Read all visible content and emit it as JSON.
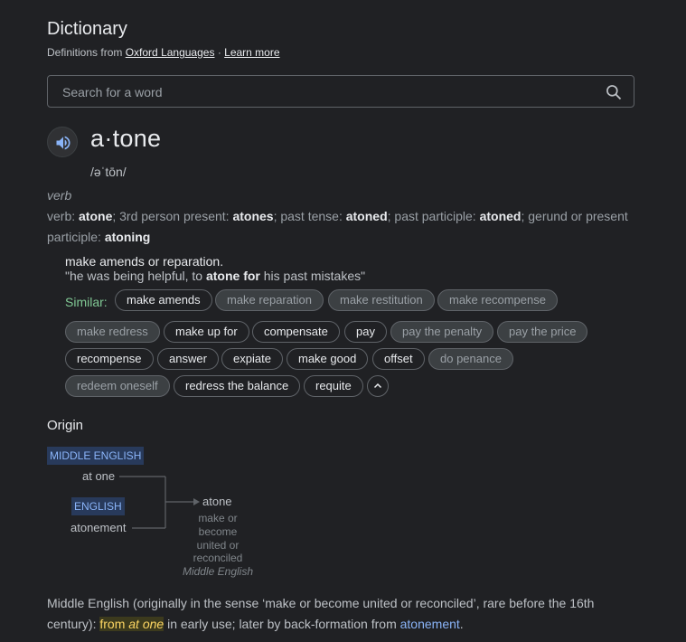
{
  "header": {
    "title": "Dictionary",
    "source_prefix": "Definitions from",
    "source_link": "Oxford Languages",
    "separator": "·",
    "learn_more": "Learn more"
  },
  "search": {
    "placeholder": "Search for a word",
    "icon": "search-icon"
  },
  "entry": {
    "speaker_icon": "speaker-icon",
    "word": "a·tone",
    "phonetic": "/əˈtōn/",
    "part_of_speech": "verb",
    "forms": {
      "label": "verb:",
      "base": "atone",
      "third_label": "3rd person present:",
      "third": "atones",
      "past_label": "past tense:",
      "past": "atoned",
      "pp_label": "past participle:",
      "pp": "atoned",
      "gerund_label": "gerund or present participle:",
      "gerund": "atoning"
    },
    "definition": "make amends or reparation.",
    "example": {
      "open": "\"he was being helpful, to",
      "bold": "atone for",
      "close": "his past mistakes\""
    },
    "similar_label": "Similar:",
    "similar": [
      "make amends",
      "make reparation",
      "make restitution",
      "make recompense",
      "make redress",
      "make up for",
      "compensate",
      "pay",
      "pay the penalty",
      "pay the price",
      "recompense",
      "answer",
      "expiate",
      "make good",
      "offset",
      "do penance",
      "redeem oneself",
      "redress the balance",
      "requite"
    ],
    "collapse_icon": "chevron-up-icon"
  },
  "origin": {
    "heading": "Origin",
    "badge_middle_english": "MIDDLE ENGLISH",
    "at_one": "at one",
    "badge_english": "ENGLISH",
    "atonement": "atonement",
    "result_word": "atone",
    "result_gloss_1": "make or",
    "result_gloss_2": "become",
    "result_gloss_3": "united or",
    "result_gloss_4": "reconciled",
    "result_lang": "Middle English",
    "etym_1": "Middle English (originally in the sense ‘make or become united or reconciled’, rare before the 16th century):",
    "etym_hl_1": "from",
    "etym_hl_2": "at one",
    "etym_2": "in early use; later by back-formation from",
    "etym_link": "atonement",
    "etym_end": "."
  },
  "colors": {
    "background": "#202124",
    "text": "#bdc1c6",
    "similar_label": "#81c995",
    "link": "#8ab4f8",
    "highlight": "#fdd663",
    "badge_bg": "#283a5b"
  }
}
